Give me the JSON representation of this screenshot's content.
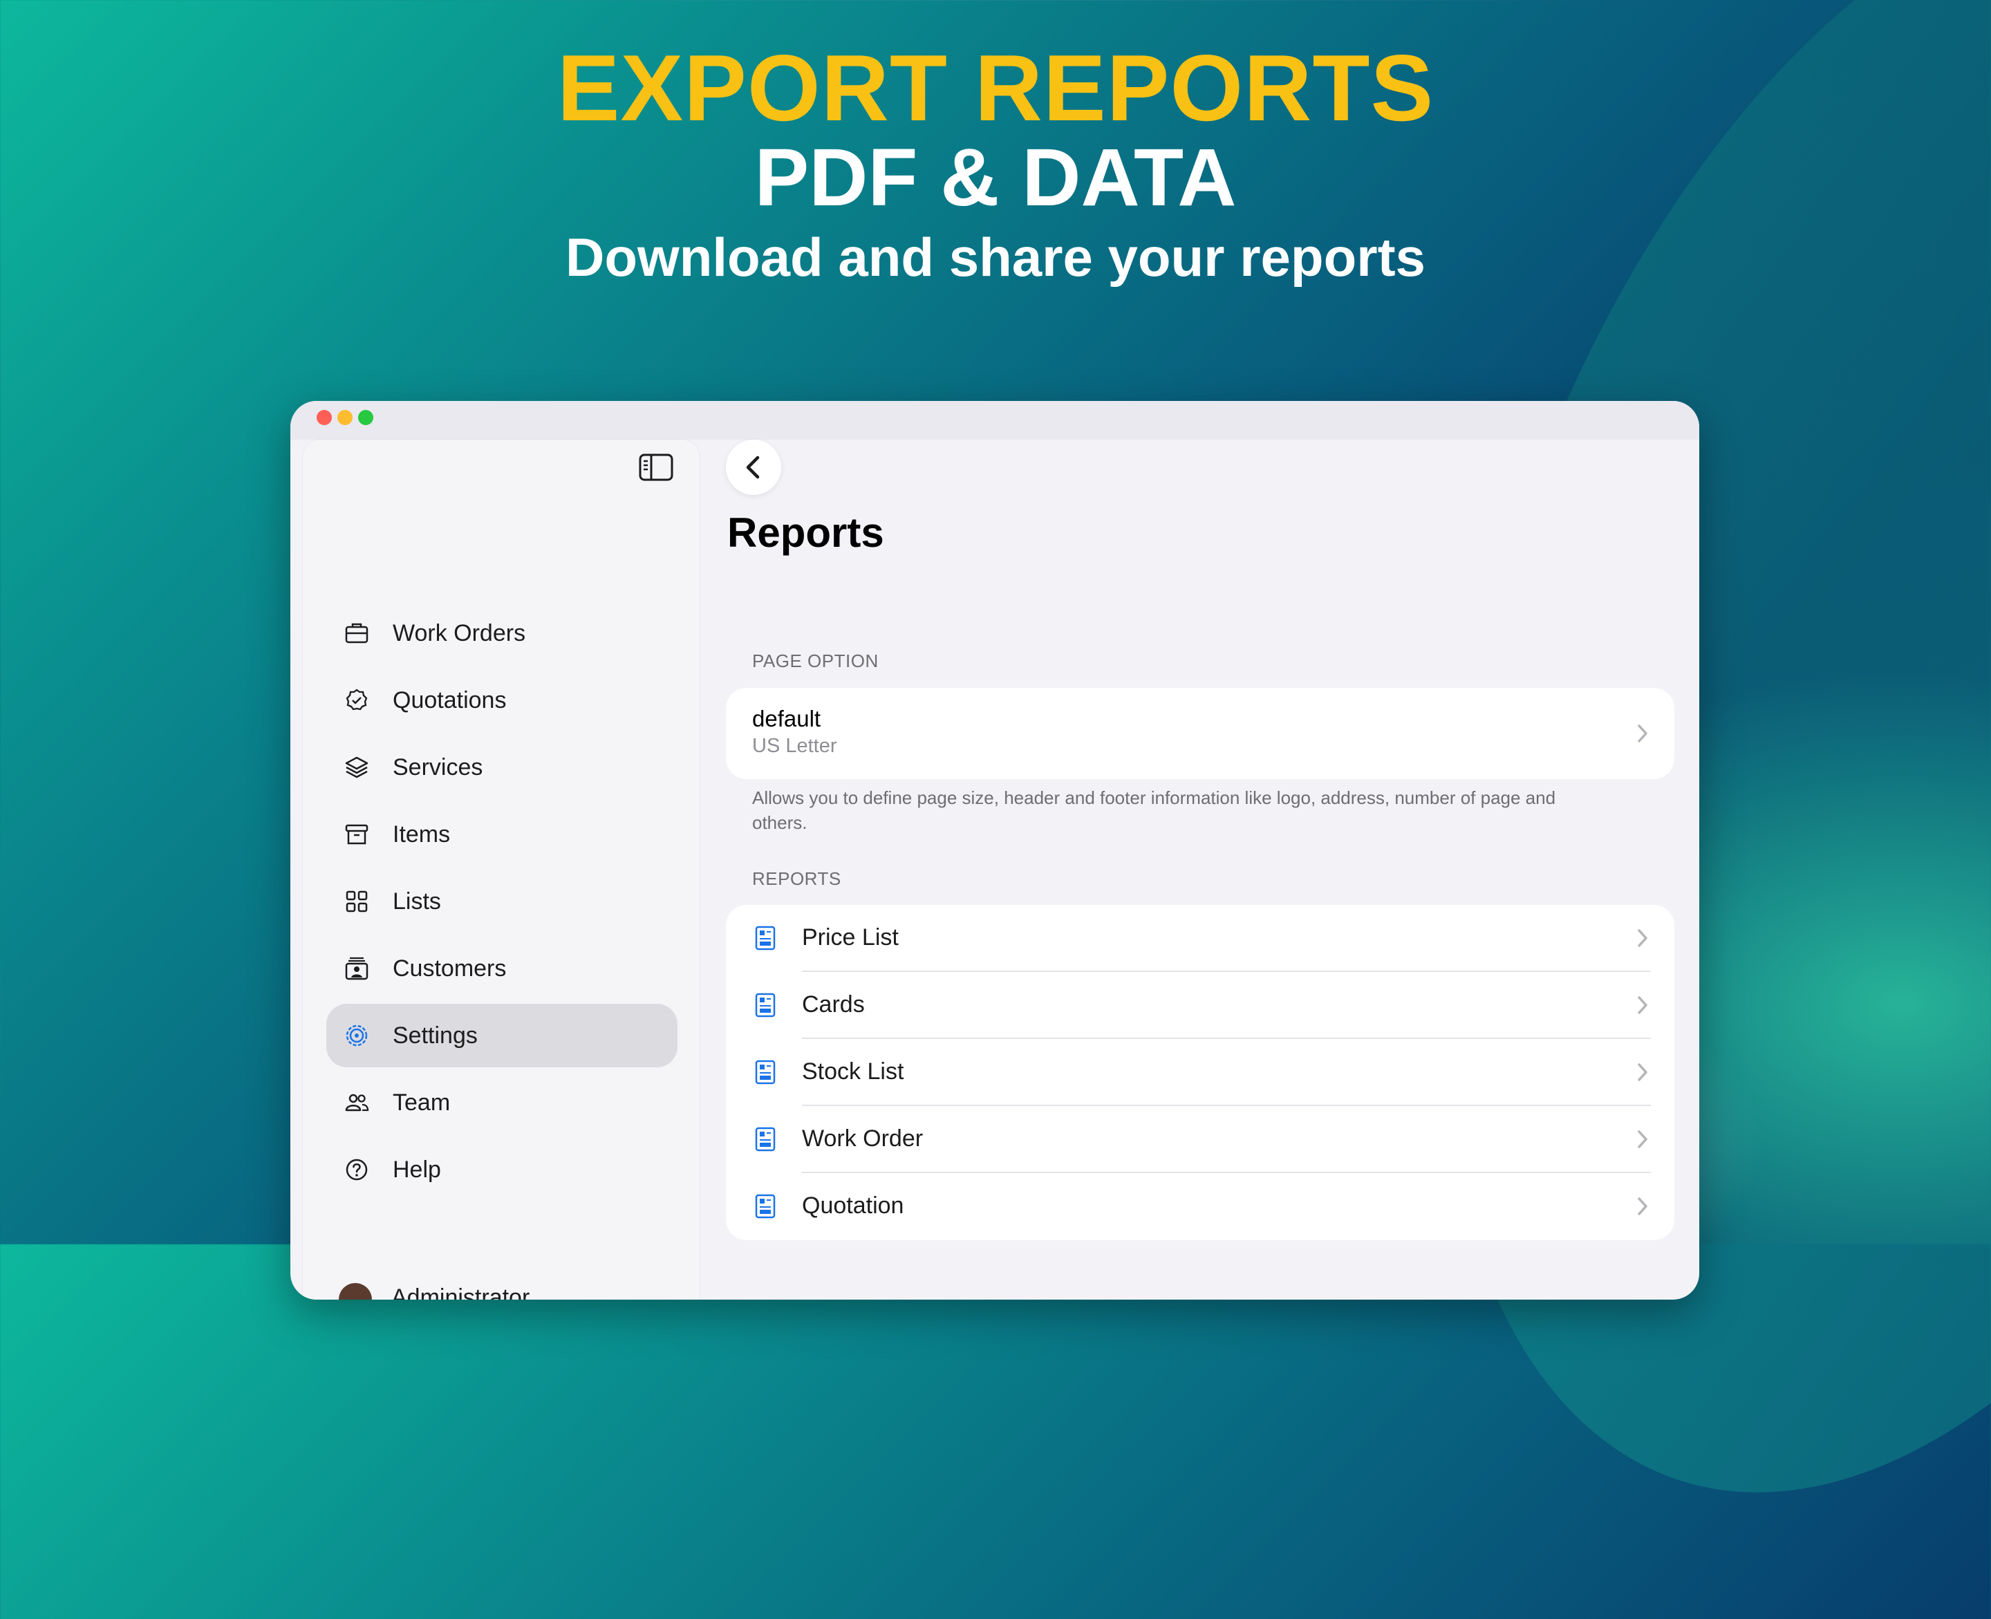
{
  "promo": {
    "headline": "EXPORT REPORTS",
    "subheadline": "PDF & DATA",
    "tagline": "Download and share your reports"
  },
  "colors": {
    "headline": "#f8c114",
    "accent": "#1a73e8",
    "window_bg": "#f2f2f7",
    "selected_item_bg": "#dcdce0"
  },
  "window": {
    "controls": [
      "close",
      "minimize",
      "zoom"
    ]
  },
  "sidebar": {
    "toggle_icon": "sidebar-toggle-icon",
    "items": [
      {
        "label": "Work Orders",
        "icon": "briefcase-icon",
        "active": false
      },
      {
        "label": "Quotations",
        "icon": "seal-check-icon",
        "active": false
      },
      {
        "label": "Services",
        "icon": "layers-icon",
        "active": false
      },
      {
        "label": "Items",
        "icon": "archive-box-icon",
        "active": false
      },
      {
        "label": "Lists",
        "icon": "grid-icon",
        "active": false
      },
      {
        "label": "Customers",
        "icon": "contact-card-icon",
        "active": false
      },
      {
        "label": "Settings",
        "icon": "gear-icon",
        "active": true
      },
      {
        "label": "Team",
        "icon": "people-icon",
        "active": false
      },
      {
        "label": "Help",
        "icon": "question-circle-icon",
        "active": false
      }
    ],
    "account_label": "Administrator"
  },
  "main": {
    "back_icon": "chevron-left-icon",
    "title": "Reports",
    "page_option": {
      "header": "PAGE OPTION",
      "name": "default",
      "size": "US Letter",
      "footnote": "Allows you to define page size, header and footer information like logo, address, number of page and others."
    },
    "reports": {
      "header": "REPORTS",
      "items": [
        "Price List",
        "Cards",
        "Stock List",
        "Work Order",
        "Quotation"
      ]
    }
  }
}
